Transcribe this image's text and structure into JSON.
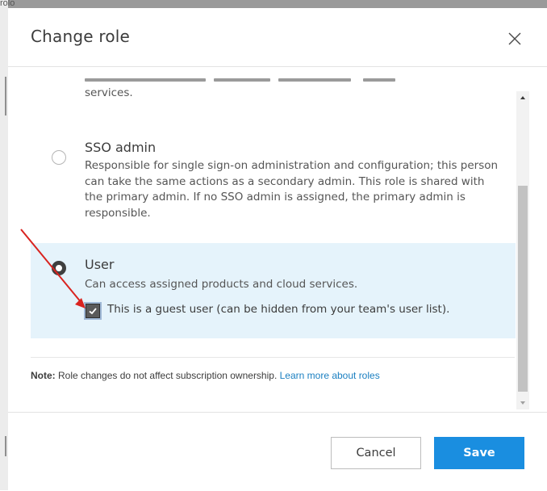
{
  "background": {
    "peek_text": "rolo"
  },
  "dialog": {
    "title": "Change role",
    "close_icon": "close-icon"
  },
  "roles": {
    "previous_desc_tail": "services.",
    "sso_admin": {
      "title": "SSO admin",
      "description": "Responsible for single sign-on administration and configuration; this person can take the same actions as a secondary admin. This role is shared with the primary admin. If no SSO admin is assigned, the primary admin is responsible.",
      "selected": false
    },
    "user": {
      "title": "User",
      "description": "Can access assigned products and cloud services.",
      "selected": true,
      "guest_checkbox": {
        "label": "This is a guest user (can be hidden from your team's user list).",
        "checked": true
      }
    }
  },
  "note": {
    "label": "Note:",
    "text": " Role changes do not affect subscription ownership. ",
    "link": "Learn more about roles"
  },
  "footer": {
    "cancel_label": "Cancel",
    "save_label": "Save"
  },
  "colors": {
    "primary": "#1a8ee0",
    "selected_row": "#e5f3fb",
    "link": "#1a7fc1",
    "annotation_arrow": "#d9231f"
  }
}
